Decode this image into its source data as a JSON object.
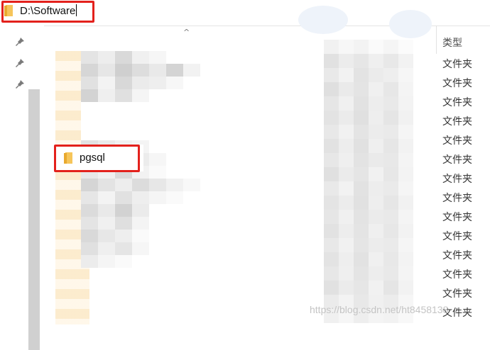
{
  "address_bar": {
    "path": "D:\\Software"
  },
  "list": {
    "sort_indicator": "^",
    "column_type": "类型",
    "highlighted_item": "pgsql",
    "type_values": [
      "文件夹",
      "文件夹",
      "文件夹",
      "文件夹",
      "文件夹",
      "文件夹",
      "文件夹",
      "文件夹",
      "文件夹",
      "文件夹",
      "文件夹",
      "文件夹",
      "文件夹",
      "文件夹"
    ]
  },
  "watermark": "https://blog.csdn.net/ht8458138",
  "colors": {
    "highlight_border": "#e3211c",
    "folder": "#f6c55a"
  }
}
